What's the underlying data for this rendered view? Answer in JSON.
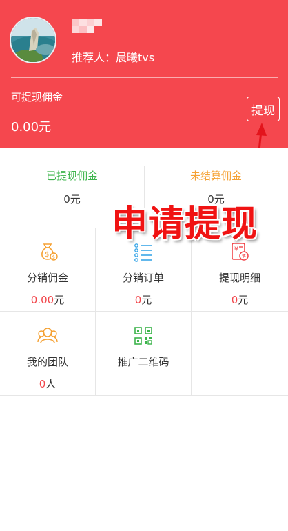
{
  "header": {
    "referrer": "推荐人：晨曦tvs",
    "withdrawable_label": "可提现佣金",
    "withdrawable_amount": "0.00元",
    "withdraw_button": "提现"
  },
  "stats": {
    "withdrawn_label": "已提现佣金",
    "withdrawn_value": "0元",
    "unsettled_label": "未结算佣金",
    "unsettled_value": "0元",
    "withdrawn_color": "#3cb44b",
    "unsettled_color": "#f5a133"
  },
  "grid": {
    "distribution_commission": {
      "label": "分销佣金",
      "value": "0.00",
      "unit": "元",
      "icon": "money-bag-icon"
    },
    "distribution_orders": {
      "label": "分销订单",
      "value": "0",
      "unit": "元",
      "icon": "list-icon"
    },
    "withdraw_details": {
      "label": "提现明细",
      "value": "0",
      "unit": "元",
      "icon": "receipt-icon"
    },
    "my_team": {
      "label": "我的团队",
      "value": "0",
      "unit": "人",
      "icon": "team-icon"
    },
    "promo_qr": {
      "label": "推广二维码",
      "icon": "qr-code-icon"
    }
  },
  "annotation": {
    "text": "申请提现"
  },
  "colors": {
    "brand_red": "#f5474e",
    "accent_red": "#f2464b",
    "icon_orange": "#f5a133",
    "icon_blue": "#3ba7e8",
    "icon_green": "#3cb44b"
  }
}
